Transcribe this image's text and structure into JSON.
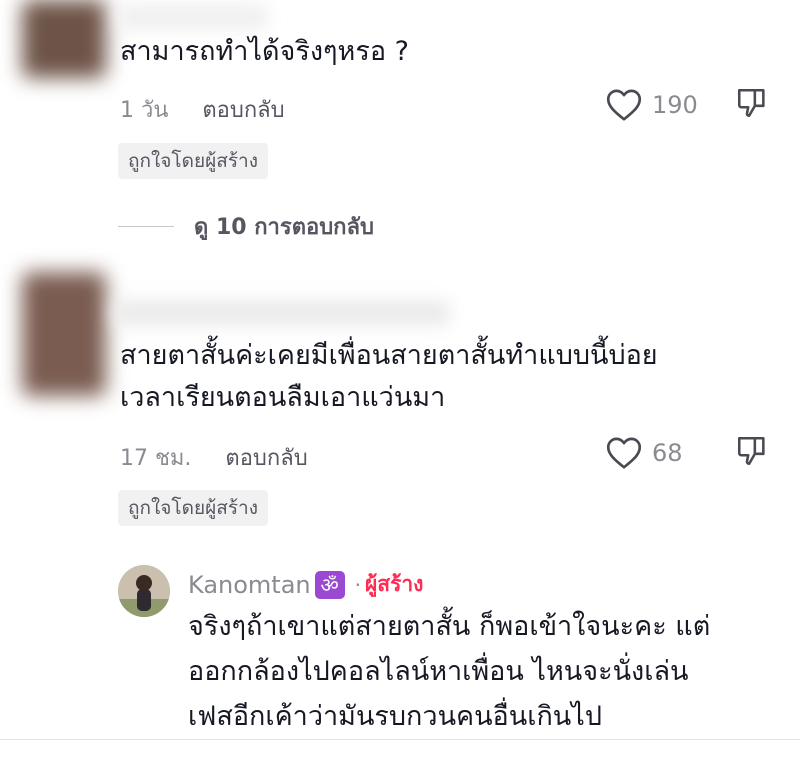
{
  "comments": [
    {
      "text": "สามารถทำได้จริงๆหรอ ?",
      "time": "1 วัน",
      "reply_label": "ตอบกลับ",
      "like_count": "190",
      "badge": "ถูกใจโดยผู้สร้าง",
      "view_replies": "ดู 10 การตอบกลับ"
    },
    {
      "text_lines": [
        "สายตาสั้นค่ะเคยมีเพื่อนสายตาสั้นทำแบบนี้บ่อย",
        "เวลาเรียนตอนลืมเอาแว่นมา"
      ],
      "time": "17 ชม.",
      "reply_label": "ตอบกลับ",
      "like_count": "68",
      "badge": "ถูกใจโดยผู้สร้าง"
    }
  ],
  "reply": {
    "username": "Kanomtan",
    "emoji": "ॐ",
    "separator": "·",
    "creator_label": "ผู้สร้าง",
    "text_lines": [
      "จริงๆถ้าเขาแต่สายตาสั้น ก็พอเข้าใจนะคะ แต่",
      "ออกกล้องไปคอลไลน์หาเพื่อน ไหนจะนั่งเล่น",
      "เฟสอีกเค้าว่ามันรบกวนคนอื่นเกินไป"
    ]
  },
  "colors": {
    "text": "#161823",
    "muted": "#8a8b91",
    "creator_accent": "#fe2c55",
    "badge_bg": "#f1f1f2"
  },
  "icons": [
    "heart-outline-icon",
    "dislike-icon"
  ]
}
